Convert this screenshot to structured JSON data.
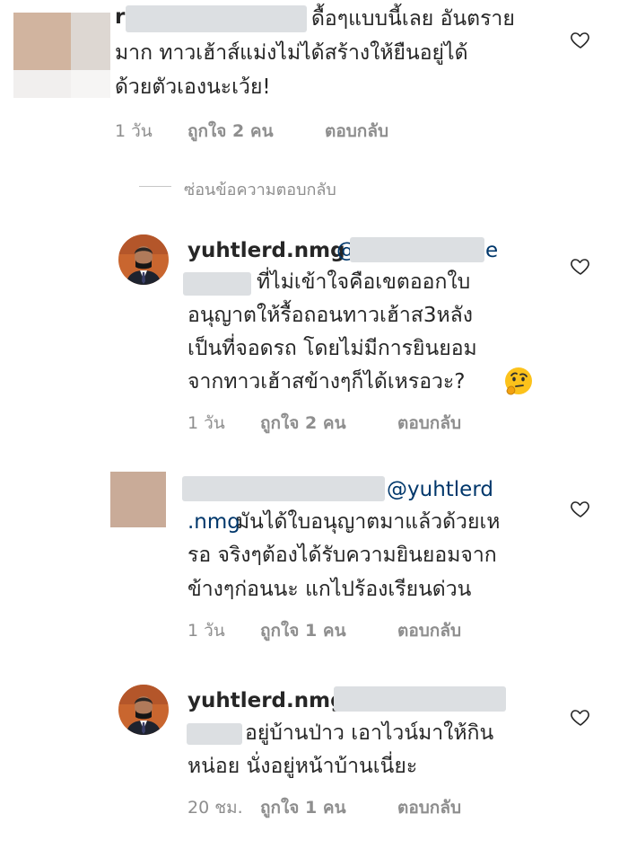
{
  "comments": [
    {
      "id": "c1",
      "username": "r",
      "lines": [
        "ดื้อๆแบบนี้เลย อันตราย",
        "มาก ทาวเฮ้าส์แม่งไม่ได้สร้างให้ยืนอยู่ได้",
        "ด้วยตัวเองนะเว้ย!"
      ],
      "time": "1 วัน",
      "likes": "ถูกใจ 2 คน",
      "reply": "ตอบกลับ"
    },
    {
      "id": "c2",
      "username": "yuhtlerd.nmg",
      "mention_start": "@",
      "mention_end": "e",
      "lines": [
        "ที่ไม่เข้าใจคือเขตออกใบ",
        "อนุญาตให้รื้อถอนทาวเฮ้าส3หลัง",
        "เป็นที่จอดรถ โดยไม่มีการยินยอม",
        "จากทาวเฮ้าสข้างๆก็ได้เหรอวะ?"
      ],
      "time": "1 วัน",
      "likes": "ถูกใจ 2 คน",
      "reply": "ตอบกลับ"
    },
    {
      "id": "c3",
      "mention": "@yuhtlerd",
      "mention_cont": ".nmg",
      "lines": [
        "มันได้ใบอนุญาตมาแล้วด้วยเห",
        "รอ จริงๆต้องได้รับความยินยอมจาก",
        "ข้างๆก่อนนะ แกไปร้องเรียนด่วน"
      ],
      "time": "1 วัน",
      "likes": "ถูกใจ 1 คน",
      "reply": "ตอบกลับ"
    },
    {
      "id": "c4",
      "username": "yuhtlerd.nmg",
      "lines": [
        "อยู่บ้านป่าว เอาไวน์มาให้กิน",
        "หน่อย นั่งอยู่หน้าบ้านเนี่ยะ"
      ],
      "time": "20 ชม.",
      "likes": "ถูกใจ 1 คน",
      "reply": "ตอบกลับ"
    }
  ],
  "hide_replies": "ซ่อนข้อความตอบกลับ",
  "icons": {
    "like": "heart-icon",
    "thinking_emoji": "thinking-face-emoji",
    "avatar": "user-avatar"
  },
  "colors": {
    "text": "#262626",
    "meta": "#8e8e8e",
    "mention": "#00376b",
    "background": "#ffffff"
  }
}
